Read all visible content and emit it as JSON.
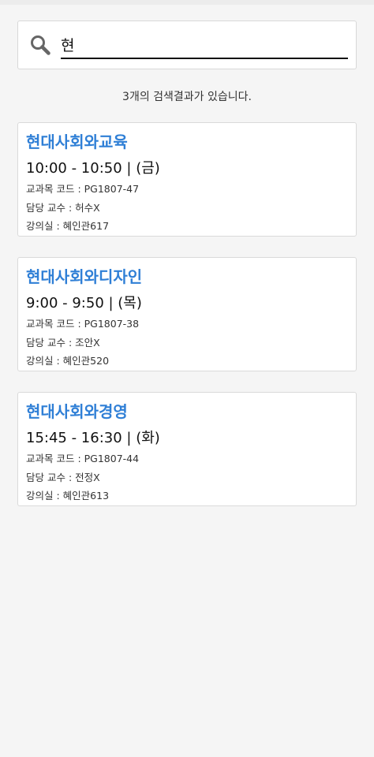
{
  "search": {
    "value": "현",
    "icon": "search-icon"
  },
  "result_count": "3개의 검색결과가 있습니다.",
  "courses": [
    {
      "title": "현대사회와교육",
      "time": "10:00 - 10:50 | (금)",
      "code": "교과목 코드 : PG1807-47",
      "professor": "담당 교수 : 허수X",
      "room": "강의실 : 혜인관617"
    },
    {
      "title": "현대사회와디자인",
      "time": "9:00 - 9:50 | (목)",
      "code": "교과목 코드 : PG1807-38",
      "professor": "담당 교수 : 조안X",
      "room": "강의실 : 혜인관520"
    },
    {
      "title": "현대사회와경영",
      "time": "15:45 - 16:30 | (화)",
      "code": "교과목 코드 : PG1807-44",
      "professor": "담당 교수 : 전정X",
      "room": "강의실 : 혜인관613"
    }
  ],
  "colors": {
    "title": "#2f7fd6",
    "background": "#f5f5f5",
    "card": "#ffffff"
  }
}
